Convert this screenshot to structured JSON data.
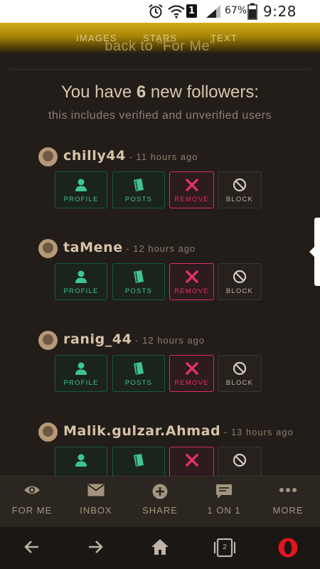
{
  "status_bar": {
    "battery_percent": "67%",
    "time": "9:28 PM",
    "sim_badge": "1",
    "icons": [
      "alarm-icon",
      "wifi-icon",
      "signal-icon",
      "battery-icon"
    ]
  },
  "top_tabs": [
    "IMAGES",
    "STARS",
    "TEXT"
  ],
  "back_link": "back to \"For Me\"",
  "header": {
    "prefix": "You have ",
    "count": "6",
    "suffix": " new followers:",
    "subtitle": "this includes verified and unverified users"
  },
  "followers": [
    {
      "username": "chilly44",
      "time": " - 11 hours ago"
    },
    {
      "username": "taMene",
      "time": " - 12 hours ago"
    },
    {
      "username": "ranig_44",
      "time": " - 12 hours ago"
    },
    {
      "username": "Malik.gulzar.Ahmad",
      "time": " - 13 hours ago"
    }
  ],
  "action_labels": {
    "profile": "PROFILE",
    "posts": "POSTS",
    "remove": "REMOVE",
    "block": "BLOCK"
  },
  "bottom_nav": [
    {
      "label": "FOR ME",
      "icon": "eye-icon"
    },
    {
      "label": "INBOX",
      "icon": "envelope-icon"
    },
    {
      "label": "SHARE",
      "icon": "plus-circle-icon"
    },
    {
      "label": "1 ON 1",
      "icon": "chat-icon"
    },
    {
      "label": "MORE",
      "icon": "more-dots-icon"
    }
  ],
  "browser_bar": {
    "tab_count": "2",
    "icons": [
      "back-arrow-icon",
      "forward-arrow-icon",
      "home-icon",
      "tabs-icon",
      "opera-icon"
    ]
  },
  "colors": {
    "accent_green": "#3ec594",
    "accent_red": "#e03363",
    "header_yellow": "#d1ae15",
    "background": "#221d19"
  }
}
